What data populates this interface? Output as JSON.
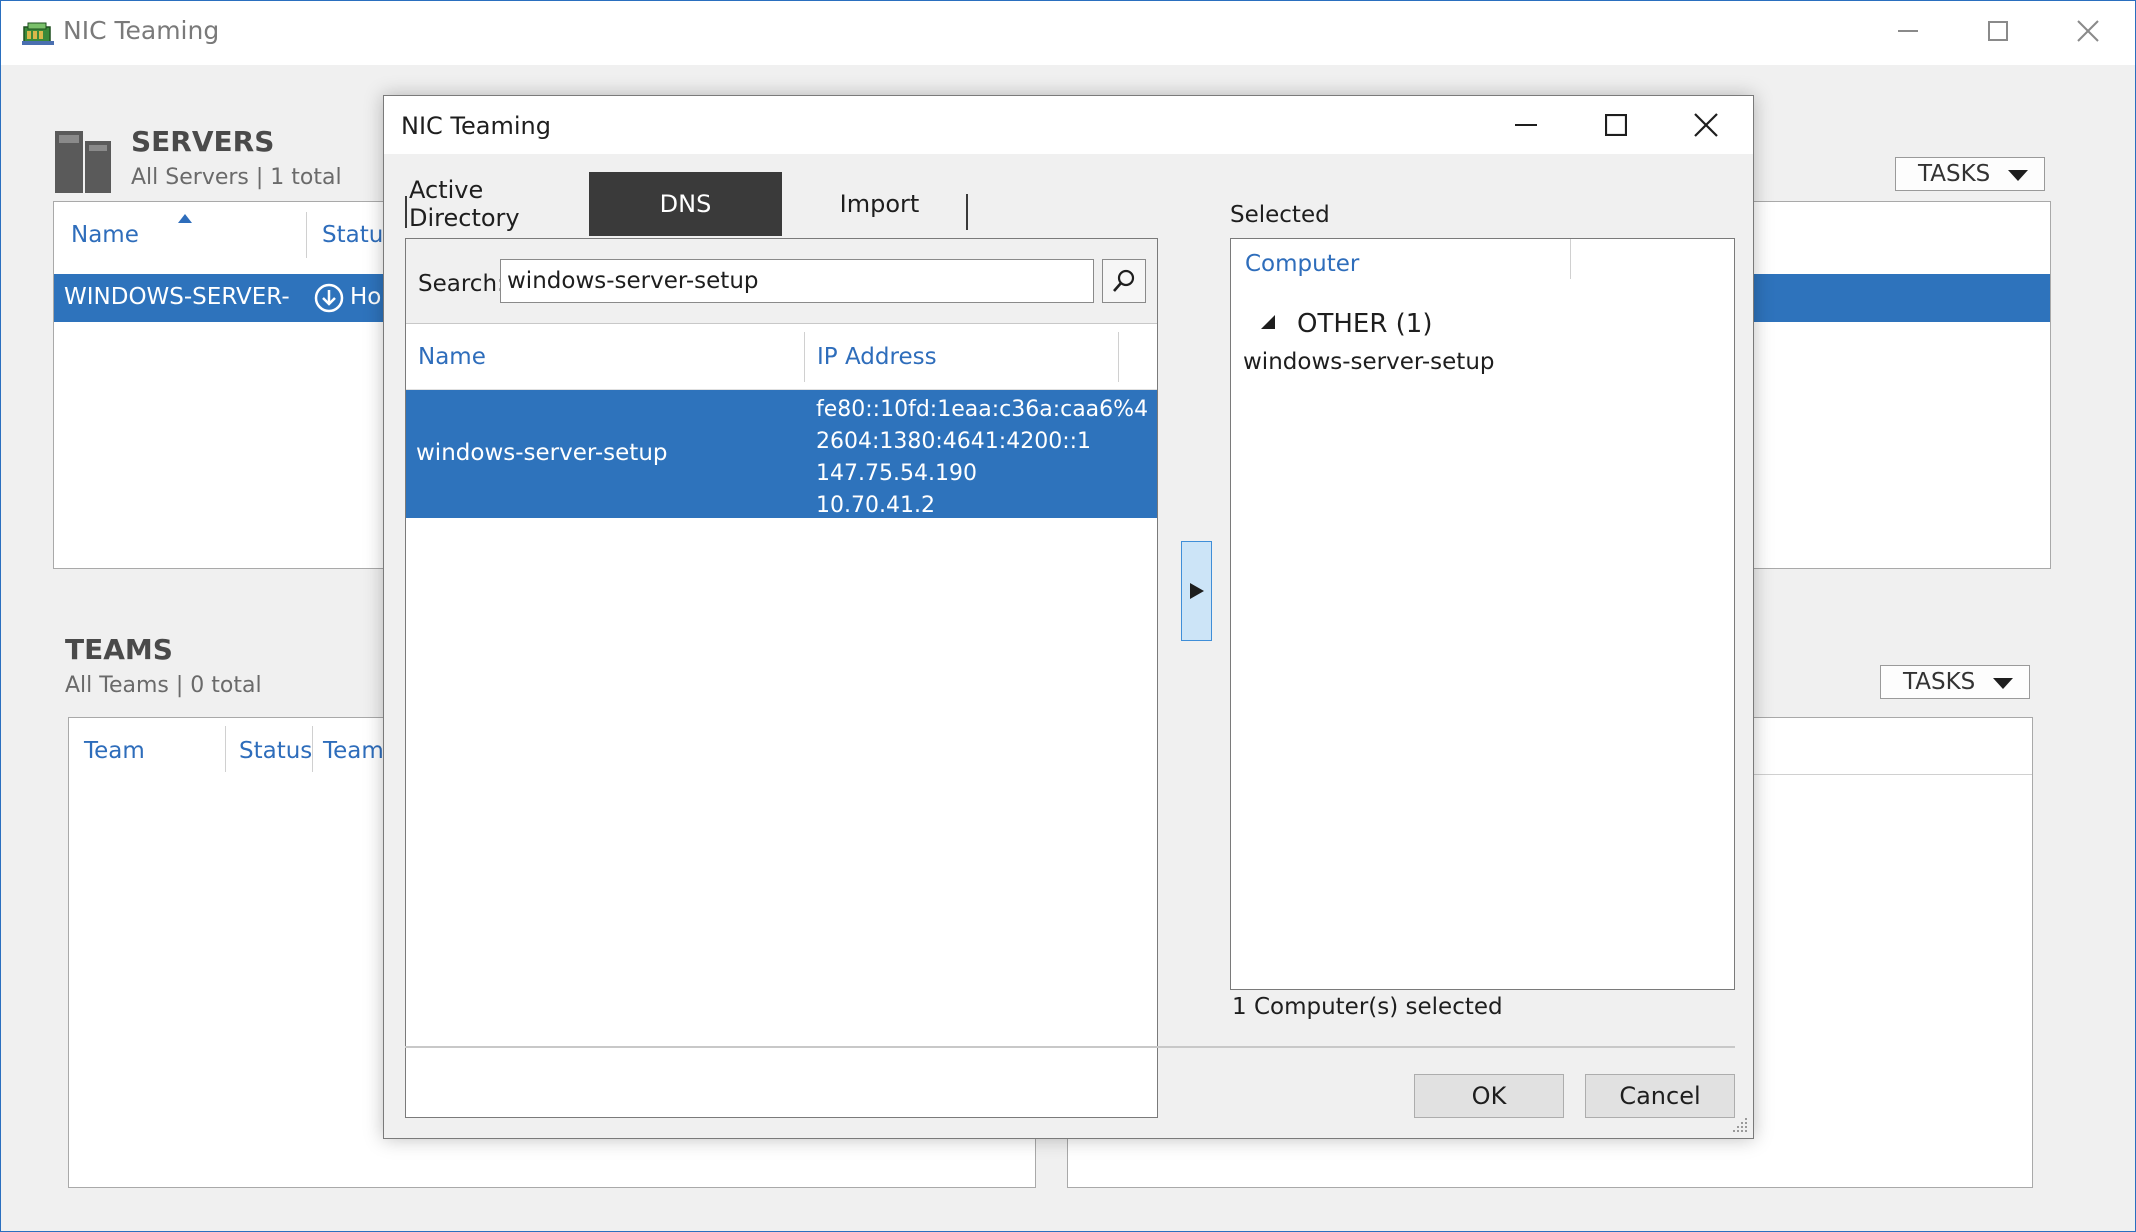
{
  "main_window": {
    "title": "NIC Teaming",
    "servers": {
      "title": "SERVERS",
      "subtitle": "All Servers | 1 total",
      "columns": [
        "Name",
        "Status"
      ],
      "row": {
        "name": "WINDOWS-SERVER-",
        "status": "Ho"
      },
      "tasks_label": "TASKS"
    },
    "teams": {
      "title": "TEAMS",
      "subtitle": "All Teams | 0 total",
      "columns": [
        "Team",
        "Status",
        "Teami"
      ],
      "tasks_label": "TASKS"
    }
  },
  "dialog": {
    "title": "NIC Teaming",
    "tabs": [
      "Active Directory",
      "DNS",
      "Import"
    ],
    "active_tab": "DNS",
    "search_label": "Search:",
    "search_value": "windows-server-setup",
    "columns": [
      "Name",
      "IP Address"
    ],
    "result": {
      "name": "windows-server-setup",
      "ips": [
        "fe80::10fd:1eaa:c36a:caa6%4",
        "2604:1380:4641:4200::1",
        "147.75.54.190",
        "10.70.41.2"
      ]
    },
    "selected_label": "Selected",
    "selected_column": "Computer",
    "selected_group": "OTHER (1)",
    "selected_item": "windows-server-setup",
    "selected_count": "1 Computer(s) selected",
    "ok_label": "OK",
    "cancel_label": "Cancel"
  },
  "colors": {
    "selection": "#2e73bc",
    "header_link": "#2e6dbb",
    "active_tab": "#3a3a3a"
  }
}
